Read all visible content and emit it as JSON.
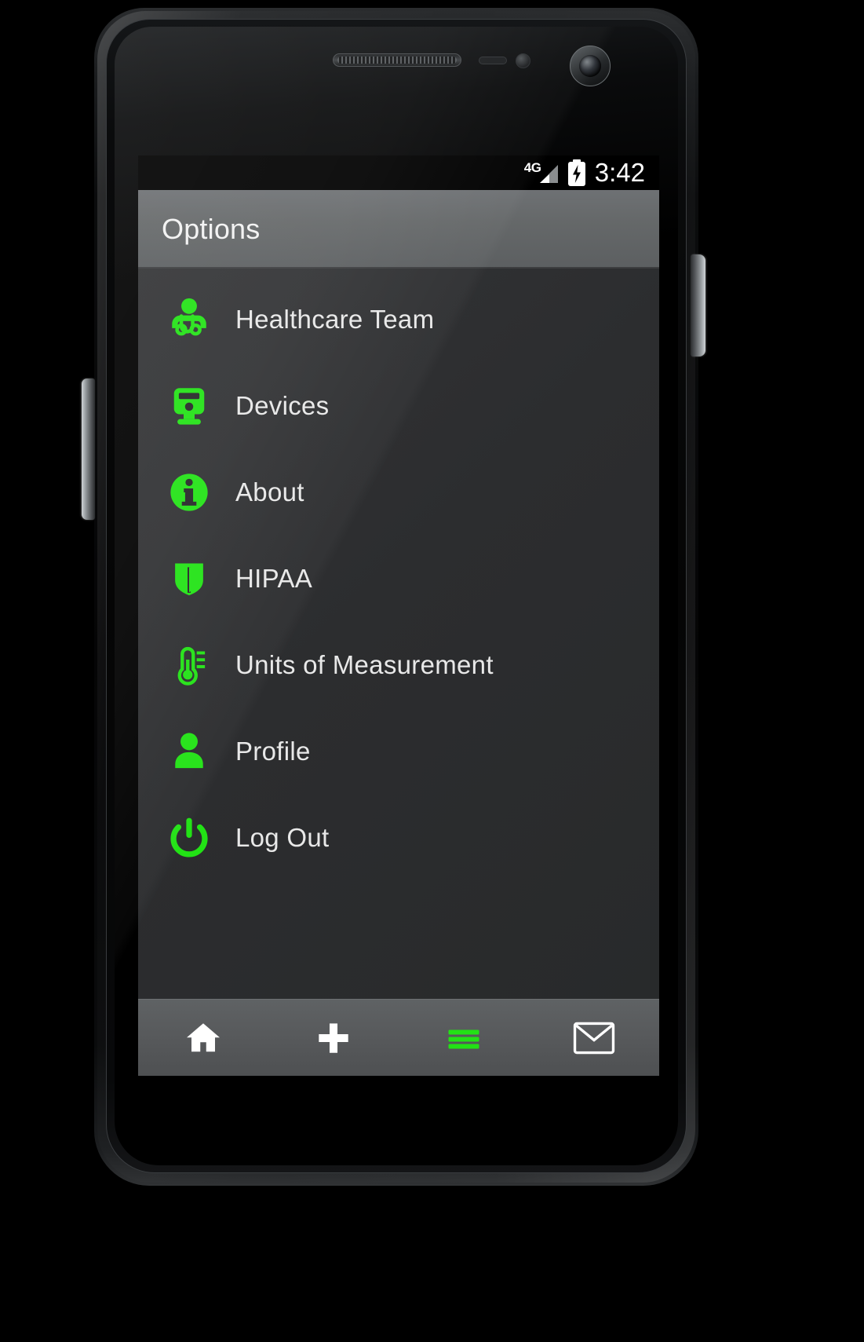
{
  "device": {
    "kind": "android-phone-mockup",
    "hardware": {
      "earpiece": "earpiece-speaker",
      "proximity_sensor": "proximity-sensor",
      "light_sensor": "light-sensor",
      "front_camera": "front-camera",
      "volume_button": "volume-rocker",
      "power_button": "power-button"
    }
  },
  "statusbar": {
    "network_label": "4G",
    "signal_icon": "signal-bars-icon",
    "battery_icon": "battery-charging-icon",
    "time": "3:42"
  },
  "actionbar": {
    "title": "Options"
  },
  "colors": {
    "accent_green": "#22e215",
    "screen_bg": "#2d2e30",
    "actionbar_bg": "#626567",
    "statusbar_bg": "#000000",
    "text_primary": "#e8e8e8",
    "nav_bg": "#57595b",
    "nav_icon_inactive": "#ffffff"
  },
  "menu": {
    "items": [
      {
        "label": "Healthcare Team",
        "icon": "doctor-stethoscope-icon"
      },
      {
        "label": "Devices",
        "icon": "device-monitor-icon"
      },
      {
        "label": "About",
        "icon": "info-circle-icon"
      },
      {
        "label": "HIPAA",
        "icon": "shield-icon"
      },
      {
        "label": "Units of Measurement",
        "icon": "thermometer-icon"
      },
      {
        "label": "Profile",
        "icon": "person-icon"
      },
      {
        "label": "Log Out",
        "icon": "power-icon"
      }
    ]
  },
  "bottomnav": {
    "items": [
      {
        "name": "home",
        "icon": "home-icon",
        "active": false
      },
      {
        "name": "add",
        "icon": "plus-icon",
        "active": false
      },
      {
        "name": "menu",
        "icon": "hamburger-icon",
        "active": true
      },
      {
        "name": "messages",
        "icon": "envelope-icon",
        "active": false
      }
    ]
  }
}
